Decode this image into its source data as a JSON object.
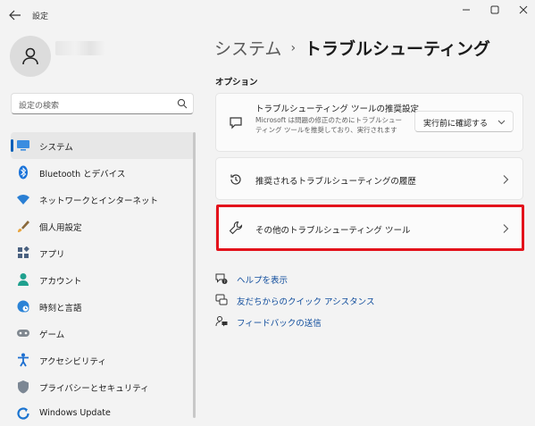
{
  "window": {
    "title": "設定",
    "controls": [
      "minimize",
      "maximize",
      "close"
    ]
  },
  "search": {
    "placeholder": "設定の検索",
    "icon": "search-icon"
  },
  "sidebar": {
    "items": [
      {
        "label": "システム",
        "icon": "system-monitor-icon",
        "selected": true
      },
      {
        "label": "Bluetooth とデバイス",
        "icon": "bluetooth-icon",
        "selected": false
      },
      {
        "label": "ネットワークとインターネット",
        "icon": "wifi-icon",
        "selected": false
      },
      {
        "label": "個人用設定",
        "icon": "brush-icon",
        "selected": false
      },
      {
        "label": "アプリ",
        "icon": "apps-icon",
        "selected": false
      },
      {
        "label": "アカウント",
        "icon": "account-icon",
        "selected": false
      },
      {
        "label": "時刻と言語",
        "icon": "globe-clock-icon",
        "selected": false
      },
      {
        "label": "ゲーム",
        "icon": "gamepad-icon",
        "selected": false
      },
      {
        "label": "アクセシビリティ",
        "icon": "accessibility-icon",
        "selected": false
      },
      {
        "label": "プライバシーとセキュリティ",
        "icon": "shield-icon",
        "selected": false
      },
      {
        "label": "Windows Update",
        "icon": "windows-update-icon",
        "selected": false
      }
    ]
  },
  "header": {
    "parent": "システム",
    "separator": "›",
    "current": "トラブルシューティング"
  },
  "options": {
    "section_title": "オプション",
    "preference": {
      "title": "トラブルシューティング ツールの推奨設定",
      "description": "Microsoft は問題の修正のためにトラブルシューティング ツールを推奨しており、実行されます",
      "dropdown_value": "実行前に確認する"
    },
    "history": {
      "title": "推奨されるトラブルシューティングの履歴"
    },
    "other": {
      "title": "その他のトラブルシューティング ツール",
      "highlight_color": "#e3121b"
    }
  },
  "help_links": [
    {
      "label": "ヘルプを表示",
      "icon": "help-icon"
    },
    {
      "label": "友だちからのクイック アシスタンス",
      "icon": "quick-assist-icon"
    },
    {
      "label": "フィードバックの送信",
      "icon": "feedback-icon"
    }
  ],
  "colors": {
    "accent": "#005fb8",
    "link": "#0f4c9c",
    "highlight": "#e3121b"
  }
}
